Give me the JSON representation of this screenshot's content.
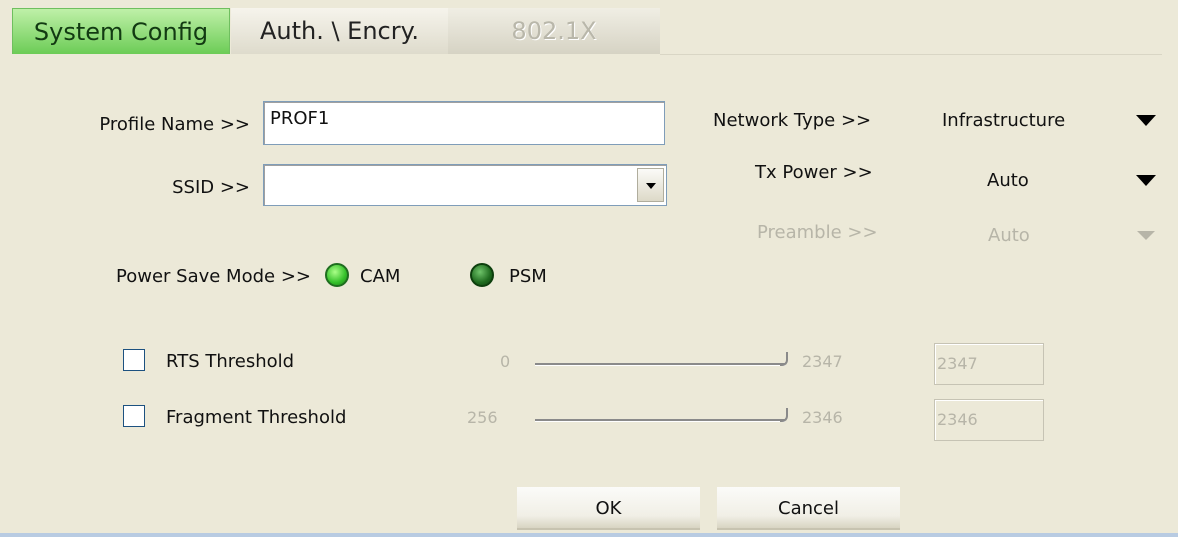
{
  "tabs": [
    {
      "label": "System Config",
      "state": "active"
    },
    {
      "label": "Auth. \\ Encry.",
      "state": "normal"
    },
    {
      "label": "802.1X",
      "state": "disabled"
    }
  ],
  "profile": {
    "label": "Profile Name >>",
    "value": "PROF1"
  },
  "ssid": {
    "label": "SSID >>",
    "value": "",
    "dropdown_icon": "chevron-down-icon"
  },
  "network_type": {
    "label": "Network Type >>",
    "value": "Infrastructure"
  },
  "tx_power": {
    "label": "Tx Power >>",
    "value": "Auto"
  },
  "preamble": {
    "label": "Preamble >>",
    "value": "Auto"
  },
  "power_save": {
    "label": "Power Save Mode >>",
    "options": [
      {
        "label": "CAM",
        "selected": true
      },
      {
        "label": "PSM",
        "selected": false
      }
    ]
  },
  "rts": {
    "label": "RTS Threshold",
    "checked": false,
    "min": "0",
    "max": "2347",
    "value": "2347"
  },
  "fragment": {
    "label": "Fragment Threshold",
    "checked": false,
    "min": "256",
    "max": "2346",
    "value": "2346"
  },
  "buttons": {
    "ok": "OK",
    "cancel": "Cancel"
  },
  "colors": {
    "active_tab": "#6ccc56",
    "background": "#ece9d8",
    "disabled_text": "#b7b5a8"
  }
}
